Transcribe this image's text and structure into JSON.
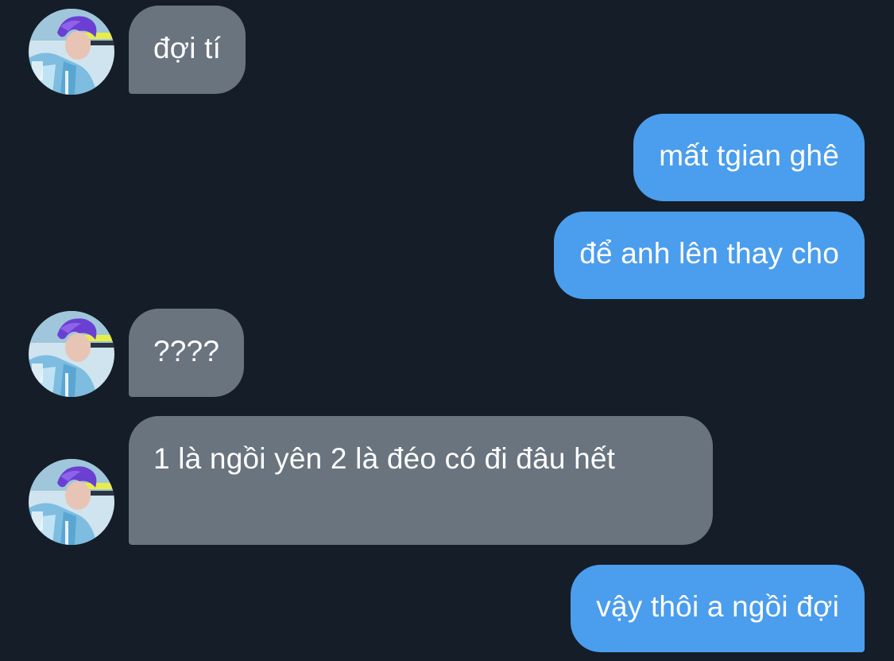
{
  "colors": {
    "background": "#151d28",
    "incoming_bubble": "#69747f",
    "outgoing_bubble": "#4b9ded",
    "text": "#ffffff"
  },
  "messages": [
    {
      "direction": "incoming",
      "text": "đợi tí"
    },
    {
      "direction": "outgoing",
      "text": "mất tgian ghê"
    },
    {
      "direction": "outgoing",
      "text": "để anh lên thay cho"
    },
    {
      "direction": "incoming",
      "text": "????"
    },
    {
      "direction": "incoming",
      "text": "1 là ngồi yên 2 là đéo có đi đâu hết"
    },
    {
      "direction": "outgoing",
      "text": "vậy thôi a ngồi đợi"
    }
  ],
  "avatar_icon": "profile-photo-icon"
}
